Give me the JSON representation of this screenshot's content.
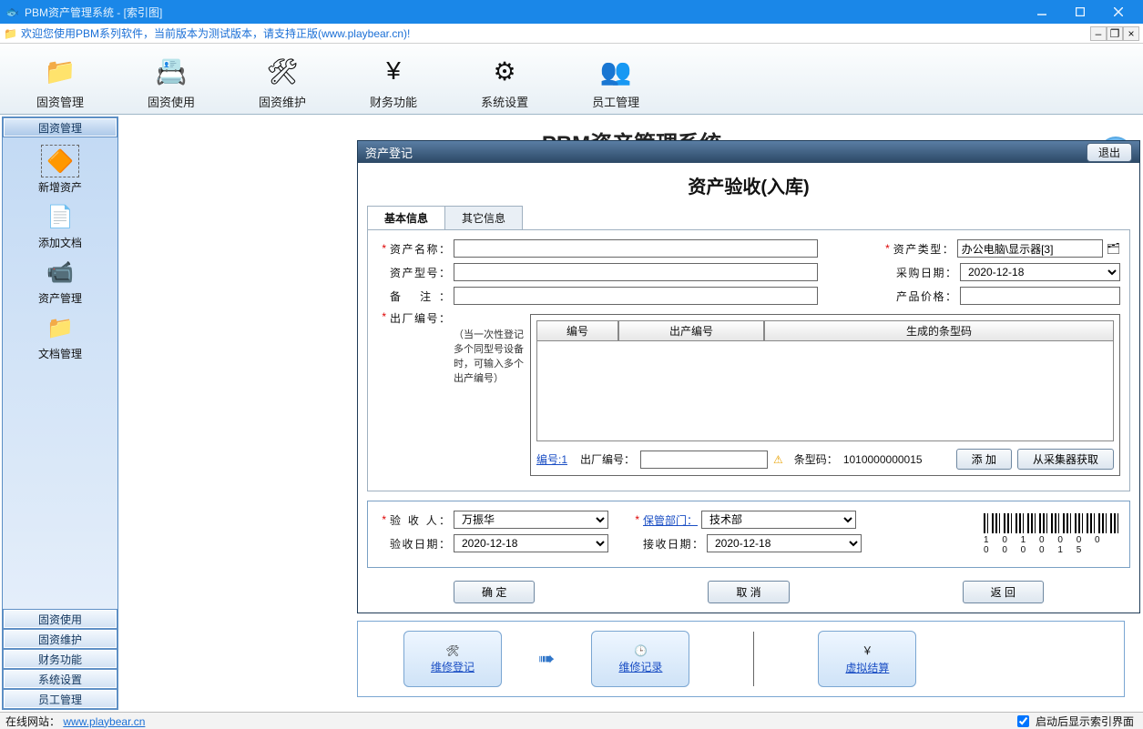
{
  "titlebar": "PBM资产管理系统 - [索引图]",
  "menubar": {
    "notice": "欢迎您使用PBM系列软件，当前版本为测试版本，请支持正版(www.playbear.cn)!"
  },
  "toolbar": [
    {
      "name": "tb-asset-manage",
      "label": "固资管理"
    },
    {
      "name": "tb-asset-use",
      "label": "固资使用"
    },
    {
      "name": "tb-asset-maint",
      "label": "固资维护"
    },
    {
      "name": "tb-finance",
      "label": "财务功能"
    },
    {
      "name": "tb-system",
      "label": "系统设置"
    },
    {
      "name": "tb-employee",
      "label": "员工管理"
    }
  ],
  "toolbar_icons": [
    "📁",
    "📇",
    "🛠",
    "¥",
    "⚙",
    "👥"
  ],
  "sidebar": {
    "nav": [
      "固资管理",
      "固资使用",
      "固资维护",
      "财务功能",
      "系统设置",
      "员工管理"
    ],
    "selected_nav": 0,
    "panel_items": [
      {
        "name": "side-add-asset",
        "label": "新增资产",
        "selected": true
      },
      {
        "name": "side-add-doc",
        "label": "添加文档"
      },
      {
        "name": "side-asset-mgr",
        "label": "资产管理"
      },
      {
        "name": "side-doc-mgr",
        "label": "文档管理"
      }
    ]
  },
  "back_title": "PBM资产管理系统",
  "help_tooltip": "帮助",
  "dialog": {
    "title": "资产登记",
    "exit": "退出",
    "heading": "资产验收(入库)",
    "tabs": [
      "基本信息",
      "其它信息"
    ],
    "active_tab": 0,
    "form": {
      "asset_name_label": "资产名称：",
      "asset_name_value": "",
      "asset_type_label": "资产类型：",
      "asset_type_value": "办公电脑\\显示器[3]",
      "asset_model_label": "资产型号：",
      "asset_model_value": "",
      "purchase_date_label": "采购日期：",
      "purchase_date_value": "2020-12-18",
      "remark_label": "备    注：",
      "remark_value": "",
      "price_label": "产品价格：",
      "price_value": "",
      "factory_sn_label": "出厂编号：",
      "factory_sn_help": "（当一次性登记多个同型号设备时，可输入多个出产编号）",
      "listview_headers": [
        "编号",
        "出产编号",
        "生成的条型码"
      ],
      "sn_prefix_link": "编号:1",
      "sn_out_label": "出厂编号：",
      "sn_out_value": "",
      "warn_tooltip": "必填",
      "barcode_label": "条型码：",
      "barcode_value": "1010000000015",
      "btn_add": "添  加",
      "btn_fromcollector": "从采集器获取"
    },
    "group": {
      "receiver_label": "验  收  人：",
      "receiver_value": "万振华",
      "dept_label": "保管部门：",
      "dept_value": "技术部",
      "check_date_label": "验收日期：",
      "check_date_value": "2020-12-18",
      "recv_date_label": "接收日期：",
      "recv_date_value": "2020-12-18",
      "barcode_text": "1 0 1 0 0 0 0 0 0 0 0 1 5"
    },
    "buttons": {
      "ok": "确  定",
      "cancel": "取  消",
      "back": "返  回"
    }
  },
  "cards": {
    "repair_reg": "维修登记",
    "repair_rec": "维修记录",
    "virtual_settle": "虚拟结算"
  },
  "status": {
    "site_label": "在线网站：",
    "site_url": "www.playbear.cn",
    "right_check": "启动后显示索引界面",
    "right_checked": true
  }
}
